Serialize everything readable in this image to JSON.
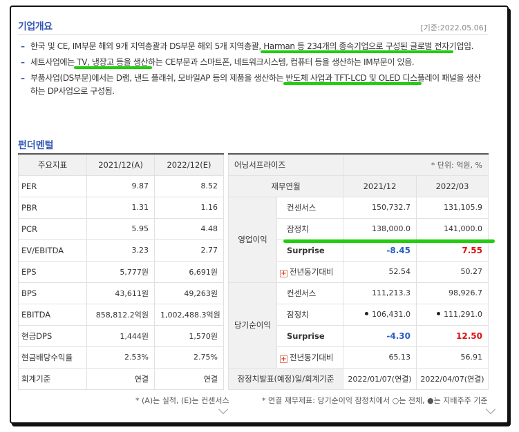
{
  "overview": {
    "title": "기업개요",
    "date_stamp": "[기준:2022.05.06]",
    "bullets": [
      {
        "pre": "한국 및 CE, IM부문 해외 9개 지역총괄과 DS부문 해외 5개 지역총괄, ",
        "hl": "Harman 등 234개의 종속기업으로 구성된 글로벌 전자",
        "post": "기업임."
      },
      {
        "pre": "세트사업에는 ",
        "hl": "TV, 냉장고 등을 생산",
        "post": "하는 CE부문과 스마트폰, 네트워크시스템, 컴퓨터 등을 생산하는 IM부문이 있음."
      },
      {
        "pre": "부품사업(DS부문)에서는 D램, 낸드 플래쉬, 모바일AP 등의 제품을 생산하는 ",
        "hl": "반도체 사업과 TFT-LCD 및 OLED 디스",
        "post": "플레이 패널을 생산하는 DP사업으로 구성됨."
      }
    ]
  },
  "fundamentals": {
    "title": "펀더멘털",
    "left_table": {
      "headers": [
        "주요지표",
        "2021/12(A)",
        "2022/12(E)"
      ],
      "rows": [
        [
          "PER",
          "9.87",
          "8.52"
        ],
        [
          "PBR",
          "1.31",
          "1.16"
        ],
        [
          "PCR",
          "5.95",
          "4.48"
        ],
        [
          "EV/EBITDA",
          "3.23",
          "2.77"
        ],
        [
          "EPS",
          "5,777원",
          "6,691원"
        ],
        [
          "BPS",
          "43,611원",
          "49,263원"
        ],
        [
          "EBITDA",
          "858,812.2억원",
          "1,002,488.3억원"
        ],
        [
          "현금DPS",
          "1,444원",
          "1,570원"
        ],
        [
          "현금배당수익률",
          "2.53%",
          "2.75%"
        ],
        [
          "회계기준",
          "연결",
          "연결"
        ]
      ],
      "note": "* (A)는 실적, (E)는 컨센서스"
    },
    "right_table": {
      "title": "어닝서프라이즈",
      "unit": "* 단위: 억원, %",
      "headers": [
        "재무연월",
        "2021/12",
        "2022/03"
      ],
      "op_group": "영업이익",
      "op_rows": [
        {
          "label": "컨센서스",
          "v1": "150,732.7",
          "v2": "131,105.9"
        },
        {
          "label": "잠정치",
          "v1": "138,000.0",
          "v2": "141,000.0"
        },
        {
          "label": "Surprise",
          "v1": "-8.45",
          "v2": "7.55"
        },
        {
          "label": "전년동기대비",
          "v1": "52.54",
          "v2": "50.27"
        }
      ],
      "ni_group": "당기순이익",
      "ni_rows": [
        {
          "label": "컨센서스",
          "v1": "111,213.3",
          "v2": "98,926.7"
        },
        {
          "label": "잠정치",
          "v1": "106,431.0",
          "v2": "111,291.0"
        },
        {
          "label": "Surprise",
          "v1": "-4.30",
          "v2": "12.50"
        },
        {
          "label": "전년동기대비",
          "v1": "65.13",
          "v2": "56.91"
        }
      ],
      "footer_label": "잠정치발표(예정)일/회계기준",
      "footer_v1": "2022/01/07(연결)",
      "footer_v2": "2022/04/07(연결)",
      "note": "* 연결 재무제표: 당기순이익 잠정치에서 ○는 전체, ●는 지배주주 기준"
    }
  },
  "colors": {
    "accent": "#3559b5",
    "highlight": "#22cc11",
    "negative": "#2b5fc7",
    "positive": "#d11111"
  },
  "icons": [
    "plus-icon",
    "chevron-down-icon"
  ]
}
